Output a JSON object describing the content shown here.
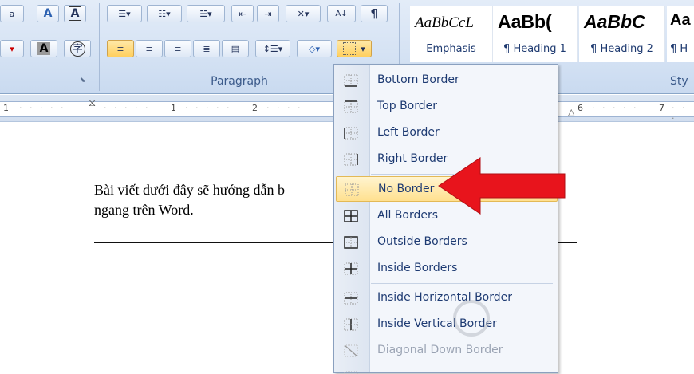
{
  "ribbon": {
    "paragraph_group_label": "Paragraph",
    "styles_group_label": "Sty",
    "styles": [
      {
        "sample": "AaBbCcL",
        "name": "Emphasis"
      },
      {
        "sample": "AaBb(",
        "name": "¶ Heading 1"
      },
      {
        "sample": "AaBbC",
        "name": "¶ Heading 2"
      },
      {
        "sample": "Aa",
        "name": "¶ H"
      }
    ]
  },
  "ruler": {
    "marks": [
      "1",
      "1",
      "2",
      "6",
      "7"
    ]
  },
  "document": {
    "line1": "Bài viết dưới đây sẽ hướng dẫn b",
    "line2": "ngang trên Word."
  },
  "border_menu": {
    "items": [
      {
        "label": "Bottom Border",
        "state": "enabled"
      },
      {
        "label": "Top Border",
        "state": "enabled"
      },
      {
        "label": "Left Border",
        "state": "enabled"
      },
      {
        "label": "Right Border",
        "state": "enabled"
      },
      {
        "label": "No Border",
        "state": "highlighted"
      },
      {
        "label": "All Borders",
        "state": "enabled"
      },
      {
        "label": "Outside Borders",
        "state": "enabled"
      },
      {
        "label": "Inside Borders",
        "state": "enabled"
      },
      {
        "label": "Inside Horizontal Border",
        "state": "enabled"
      },
      {
        "label": "Inside Vertical Border",
        "state": "enabled"
      },
      {
        "label": "Diagonal Down Border",
        "state": "disabled"
      }
    ]
  },
  "colors": {
    "accent_arrow": "#e8141c",
    "menu_highlight": "#ffe08f"
  }
}
